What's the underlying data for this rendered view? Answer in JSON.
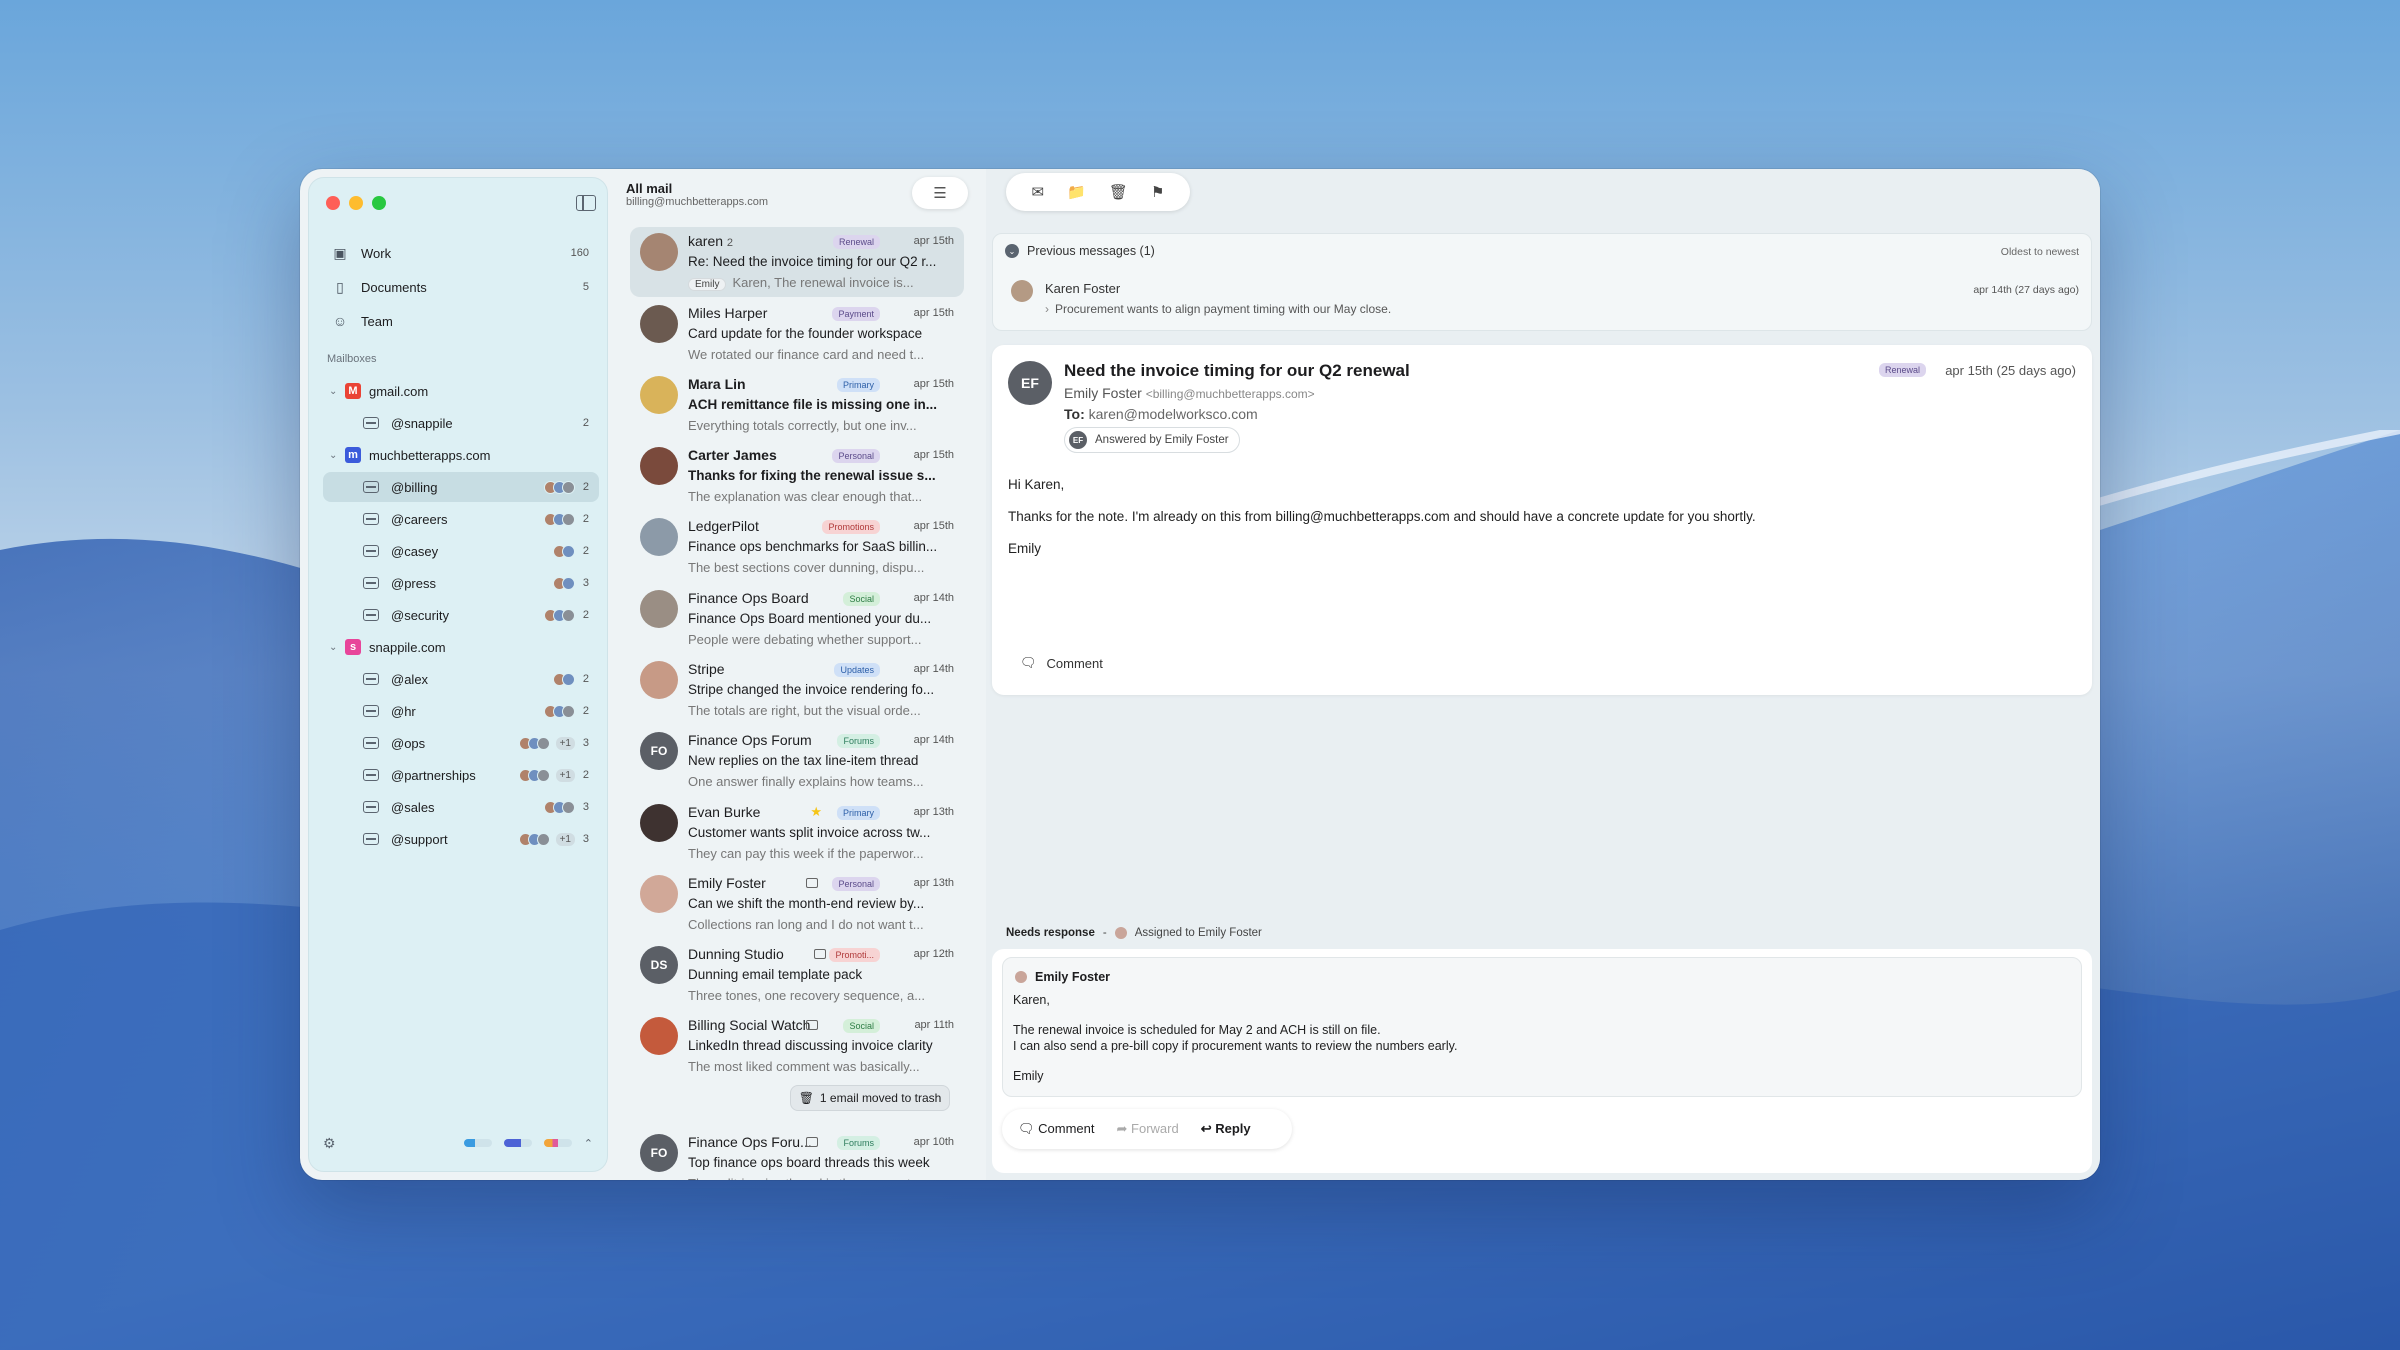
{
  "colors": {
    "accent": "#5b4b8a",
    "sidebar_bg": "#ddf0f4",
    "tag_renewal": "#dcd5ee",
    "tag_payment": "#dcd5ee",
    "tag_primary": "#cfe0f7",
    "tag_personal": "#dcd5ee",
    "tag_promotions": "#f7d3d3",
    "tag_social": "#d4efd9",
    "tag_updates": "#cfe0f7",
    "tag_forums": "#d4efe3"
  },
  "sidebar": {
    "nav": [
      {
        "label": "Work",
        "count": "160",
        "icon": "inbox-icon"
      },
      {
        "label": "Documents",
        "count": "5",
        "icon": "document-icon"
      },
      {
        "label": "Team",
        "count": "",
        "icon": "people-icon"
      }
    ],
    "section_title": "Mailboxes",
    "accounts": [
      {
        "domain": "gmail.com",
        "icon": "gmail-icon",
        "mailboxes": [
          {
            "label": "@snappile",
            "count": "2",
            "avatars": 0,
            "plus": ""
          }
        ]
      },
      {
        "domain": "muchbetterapps.com",
        "icon": "muchbetterapps-icon",
        "mailboxes": [
          {
            "label": "@billing",
            "count": "2",
            "avatars": 3,
            "plus": ""
          },
          {
            "label": "@careers",
            "count": "2",
            "avatars": 3,
            "plus": ""
          },
          {
            "label": "@casey",
            "count": "2",
            "avatars": 2,
            "plus": ""
          },
          {
            "label": "@press",
            "count": "3",
            "avatars": 2,
            "plus": ""
          },
          {
            "label": "@security",
            "count": "2",
            "avatars": 3,
            "plus": ""
          }
        ]
      },
      {
        "domain": "snappile.com",
        "icon": "snappile-icon",
        "mailboxes": [
          {
            "label": "@alex",
            "count": "2",
            "avatars": 2,
            "plus": ""
          },
          {
            "label": "@hr",
            "count": "2",
            "avatars": 3,
            "plus": ""
          },
          {
            "label": "@ops",
            "count": "3",
            "avatars": 3,
            "plus": "+1"
          },
          {
            "label": "@partnerships",
            "count": "2",
            "avatars": 3,
            "plus": "+1"
          },
          {
            "label": "@sales",
            "count": "3",
            "avatars": 3,
            "plus": ""
          },
          {
            "label": "@support",
            "count": "3",
            "avatars": 3,
            "plus": "+1"
          }
        ]
      }
    ]
  },
  "list": {
    "title": "All mail",
    "subtitle": "billing@muchbetterapps.com",
    "trash_notice": "1 email moved to trash",
    "mails": [
      {
        "sender": "karen",
        "count": "2",
        "tag": "Renewal",
        "date": "apr 15th",
        "subject": "Re: Need the invoice timing for our Q2 r...",
        "preview": "Karen, The renewal invoice is...",
        "chip": "Emily",
        "bold": false,
        "initials": "",
        "marker": ""
      },
      {
        "sender": "Miles Harper",
        "count": "",
        "tag": "Payment",
        "date": "apr 15th",
        "subject": "Card update for the founder workspace",
        "preview": "We rotated our finance card and need t...",
        "chip": "",
        "bold": false,
        "initials": "",
        "marker": ""
      },
      {
        "sender": "Mara Lin",
        "count": "",
        "tag": "Primary",
        "date": "apr 15th",
        "subject": "ACH remittance file is missing one in...",
        "preview": "Everything totals correctly, but one inv...",
        "chip": "",
        "bold": true,
        "initials": "",
        "marker": ""
      },
      {
        "sender": "Carter James",
        "count": "",
        "tag": "Personal",
        "date": "apr 15th",
        "subject": "Thanks for fixing the renewal issue s...",
        "preview": "The explanation was clear enough that...",
        "chip": "",
        "bold": true,
        "initials": "",
        "marker": ""
      },
      {
        "sender": "LedgerPilot",
        "count": "",
        "tag": "Promotions",
        "date": "apr 15th",
        "subject": "Finance ops benchmarks for SaaS billin...",
        "preview": "The best sections cover dunning, dispu...",
        "chip": "",
        "bold": false,
        "initials": "",
        "marker": ""
      },
      {
        "sender": "Finance Ops Board",
        "count": "",
        "tag": "Social",
        "date": "apr 14th",
        "subject": "Finance Ops Board mentioned your du...",
        "preview": "People were debating whether support...",
        "chip": "",
        "bold": false,
        "initials": "",
        "marker": ""
      },
      {
        "sender": "Stripe",
        "count": "",
        "tag": "Updates",
        "date": "apr 14th",
        "subject": "Stripe changed the invoice rendering fo...",
        "preview": "The totals are right, but the visual orde...",
        "chip": "",
        "bold": false,
        "initials": "",
        "marker": ""
      },
      {
        "sender": "Finance Ops Forum",
        "count": "",
        "tag": "Forums",
        "date": "apr 14th",
        "subject": "New replies on the tax line-item thread",
        "preview": "One answer finally explains how teams...",
        "chip": "",
        "bold": false,
        "initials": "FO",
        "marker": ""
      },
      {
        "sender": "Evan Burke",
        "count": "",
        "tag": "Primary",
        "date": "apr 13th",
        "subject": "Customer wants split invoice across tw...",
        "preview": "They can pay this week if the paperwor...",
        "chip": "",
        "bold": false,
        "initials": "",
        "marker": "star"
      },
      {
        "sender": "Emily Foster",
        "count": "",
        "tag": "Personal",
        "date": "apr 13th",
        "subject": "Can we shift the month-end review by...",
        "preview": "Collections ran long and I do not want t...",
        "chip": "",
        "bold": false,
        "initials": "",
        "marker": "archive"
      },
      {
        "sender": "Dunning Studio",
        "count": "",
        "tag": "Promoti...",
        "date": "apr 12th",
        "subject": "Dunning email template pack",
        "preview": "Three tones, one recovery sequence, a...",
        "chip": "",
        "bold": false,
        "initials": "DS",
        "marker": "archive"
      },
      {
        "sender": "Billing Social Watch",
        "count": "",
        "tag": "Social",
        "date": "apr 11th",
        "subject": "LinkedIn thread discussing invoice clarity",
        "preview": "The most liked comment was basically...",
        "chip": "",
        "bold": false,
        "initials": "",
        "marker": "archive"
      },
      {
        "sender": "Finance Ops Foru...",
        "count": "",
        "tag": "Forums",
        "date": "apr 10th",
        "subject": "Top finance ops board threads this week",
        "preview": "The split-invoice thread is the one wort...",
        "chip": "",
        "bold": false,
        "initials": "FO",
        "marker": "archive"
      }
    ]
  },
  "reader": {
    "previous": {
      "label": "Previous messages (1)",
      "order": "Oldest to newest",
      "from": "Karen Foster",
      "snippet": "Procurement wants to align payment timing with our May close.",
      "date": "apr 14th (27 days ago)"
    },
    "message": {
      "initials": "EF",
      "subject": "Need the invoice timing for our Q2 renewal",
      "tag": "Renewal",
      "date": "apr 15th (25 days ago)",
      "from_name": "Emily Foster",
      "from_email": "<billing@muchbetterapps.com>",
      "to_label": "To:",
      "to": "karen@modelworksco.com",
      "answered": "Answered by Emily Foster",
      "answered_initials": "EF",
      "body": [
        "Hi Karen,",
        "Thanks for the note. I'm already on this from billing@muchbetterapps.com and should have a concrete update for you shortly.",
        "Emily"
      ],
      "comment": "Comment"
    },
    "status": {
      "label": "Needs response",
      "sep": "-",
      "assigned": "Assigned to Emily Foster"
    },
    "draft": {
      "author": "Emily Foster",
      "lines": [
        "Karen,",
        "",
        "The renewal invoice is scheduled for May 2 and ACH is still on file.",
        "I can also send a pre-bill copy if procurement wants to review the numbers early.",
        "",
        "Emily"
      ]
    },
    "actions": {
      "comment": "Comment",
      "forward": "Forward",
      "reply": "Reply"
    }
  }
}
